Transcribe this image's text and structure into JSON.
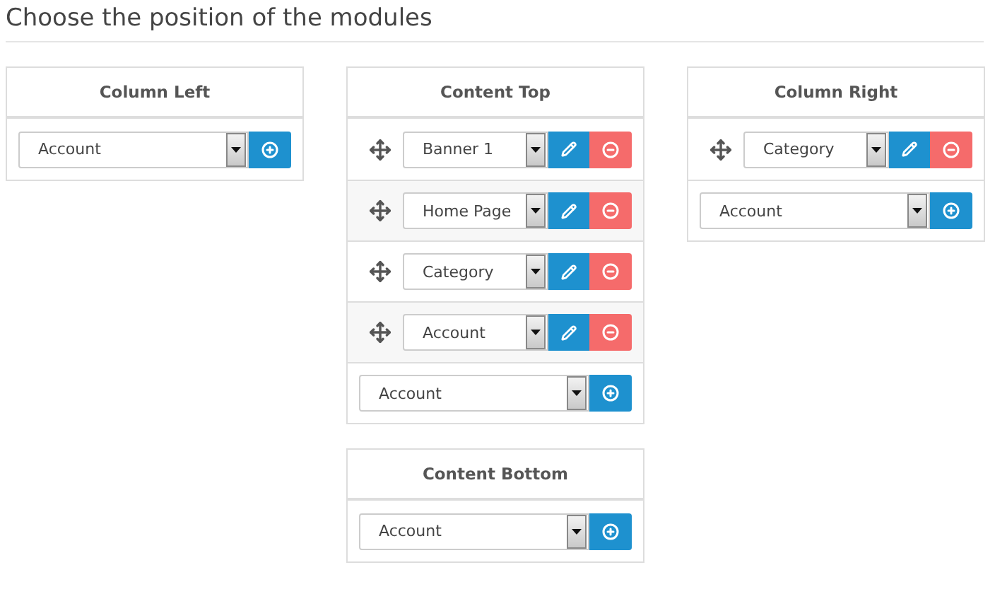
{
  "page_title": "Choose the position of the modules",
  "columns": [
    {
      "panels": [
        {
          "title": "Column Left",
          "add": {
            "value": "Account"
          }
        }
      ]
    },
    {
      "panels": [
        {
          "title": "Content Top",
          "modules": [
            {
              "value": "Banner 1"
            },
            {
              "value": "Home Page"
            },
            {
              "value": "Category"
            },
            {
              "value": "Account"
            }
          ],
          "add": {
            "value": "Account"
          }
        },
        {
          "title": "Content Bottom",
          "add": {
            "value": "Account"
          }
        }
      ]
    },
    {
      "panels": [
        {
          "title": "Column Right",
          "modules": [
            {
              "value": "Category"
            }
          ],
          "add": {
            "value": "Account"
          }
        }
      ]
    }
  ]
}
